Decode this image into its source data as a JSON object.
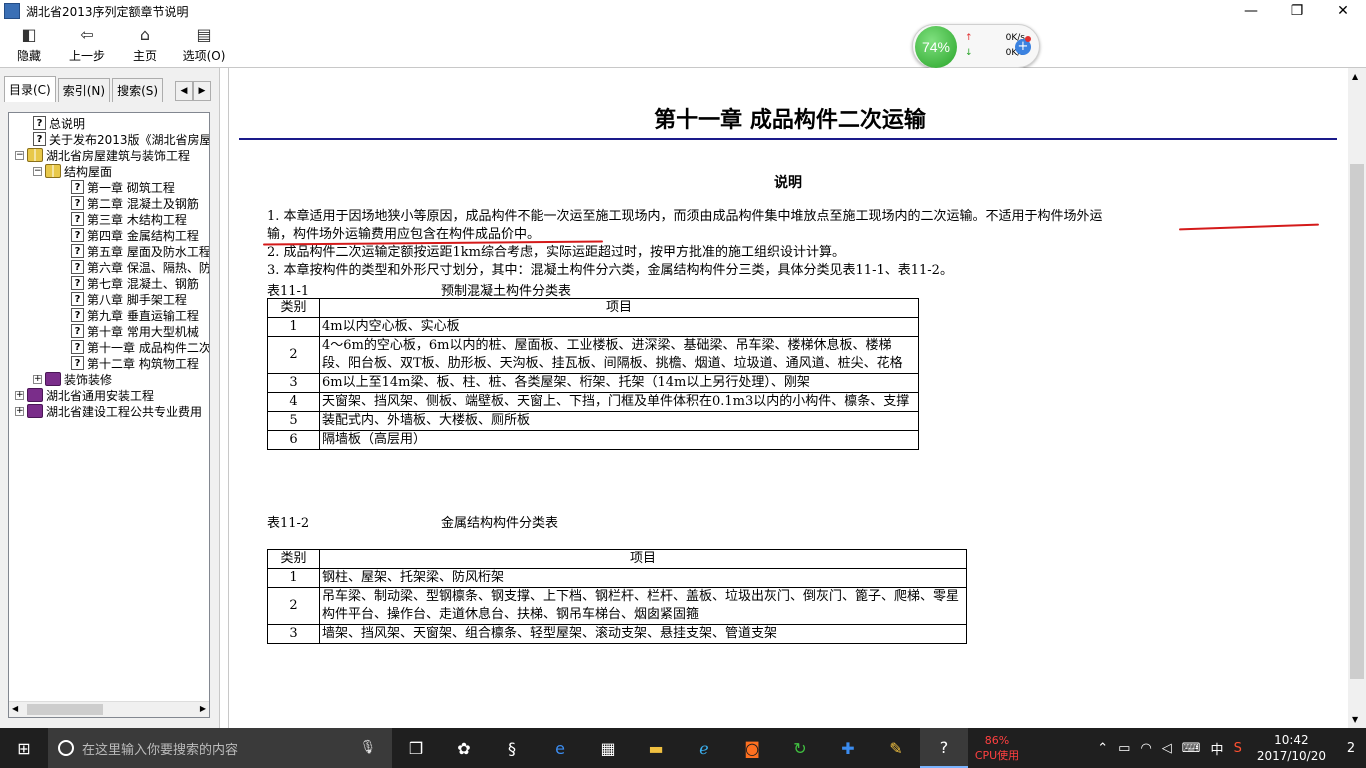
{
  "window": {
    "title": "湖北省2013序列定额章节说明"
  },
  "toolbar": {
    "hide": "隐藏",
    "back": "上一步",
    "home": "主页",
    "options": "选项(O)"
  },
  "net_widget": {
    "percent": "74%",
    "up": "0K/s",
    "down": "0K/s"
  },
  "left_tabs": {
    "toc": "目录(C)",
    "index": "索引(N)",
    "search": "搜索(S)"
  },
  "tree": [
    {
      "label": "总说明",
      "icon": "help-page-icon"
    },
    {
      "label": "关于发布2013版《湖北省房屋",
      "icon": "help-page-icon"
    },
    {
      "label": "湖北省房屋建筑与装饰工程",
      "icon": "open-book-icon"
    },
    {
      "label": "结构屋面",
      "icon": "open-book-icon"
    },
    {
      "label": "第一章 砌筑工程",
      "icon": "help-page-icon"
    },
    {
      "label": "第二章 混凝土及钢筋",
      "icon": "help-page-icon"
    },
    {
      "label": "第三章 木结构工程",
      "icon": "help-page-icon"
    },
    {
      "label": "第四章 金属结构工程",
      "icon": "help-page-icon"
    },
    {
      "label": "第五章 屋面及防水工程",
      "icon": "help-page-icon"
    },
    {
      "label": "第六章 保温、隔热、防",
      "icon": "help-page-icon"
    },
    {
      "label": "第七章 混凝土、钢筋",
      "icon": "help-page-icon"
    },
    {
      "label": "第八章 脚手架工程",
      "icon": "help-page-icon"
    },
    {
      "label": "第九章 垂直运输工程",
      "icon": "help-page-icon"
    },
    {
      "label": "第十章 常用大型机械",
      "icon": "help-page-icon"
    },
    {
      "label": "第十一章 成品构件二次",
      "icon": "help-page-icon"
    },
    {
      "label": "第十二章 构筑物工程",
      "icon": "help-page-icon"
    },
    {
      "label": "装饰装修",
      "icon": "closed-book-icon"
    },
    {
      "label": "湖北省通用安装工程",
      "icon": "closed-book-icon"
    },
    {
      "label": "湖北省建设工程公共专业费用",
      "icon": "closed-book-icon"
    }
  ],
  "content": {
    "chapter_title": "第十一章 成品构件二次运输",
    "section_title": "说明",
    "para1_line1": "1. 本章适用于因场地狭小等原因，成品构件不能一次运至施工现场内，而须由成品构件集中堆放点至施工现场内的二次运输。不适用于构件场外运",
    "para1_line2": "输，构件场外运输费用应包含在构件成品价中。",
    "para2": "2. 成品构件二次运输定额按运距1km综合考虑，实际运距超过时，按甲方批准的施工组织设计计算。",
    "para3": "3. 本章按构件的类型和外形尺寸划分，其中：混凝土构件分六类，金属结构构件分三类，具体分类见表11-1、表11-2。",
    "table1": {
      "label": "表11-1",
      "name": "预制混凝土构件分类表",
      "headers": [
        "类别",
        "项目"
      ],
      "rows": [
        [
          "1",
          "4m以内空心板、实心板"
        ],
        [
          "2",
          "4～6m的空心板，6m以内的桩、屋面板、工业楼板、进深梁、基础梁、吊车梁、楼梯休息板、楼梯段、阳台板、双T板、肋形板、天沟板、挂瓦板、间隔板、挑檐、烟道、垃圾道、通风道、桩尖、花格"
        ],
        [
          "3",
          "6m以上至14m梁、板、柱、桩、各类屋架、桁架、托架（14m以上另行处理）、刚架"
        ],
        [
          "4",
          "天窗架、挡风架、侧板、端壁板、天窗上、下挡，门框及单件体积在0.1m3以内的小构件、檩条、支撑"
        ],
        [
          "5",
          "装配式内、外墙板、大楼板、厕所板"
        ],
        [
          "6",
          "隔墙板（高层用）"
        ]
      ]
    },
    "table2": {
      "label": "表11-2",
      "name": "金属结构构件分类表",
      "headers": [
        "类别",
        "项目"
      ],
      "rows": [
        [
          "1",
          "钢柱、屋架、托架梁、防风桁架"
        ],
        [
          "2",
          "吊车梁、制动梁、型钢檩条、钢支撑、上下档、钢栏杆、栏杆、盖板、垃圾出灰门、倒灰门、篦子、爬梯、零星构件平台、操作台、走道休息台、扶梯、钢吊车梯台、烟囱紧固箍"
        ],
        [
          "3",
          "墙架、挡风架、天窗架、组合檩条、轻型屋架、滚动支架、悬挂支架、管道支架"
        ]
      ]
    }
  },
  "taskbar": {
    "search_placeholder": "在这里输入你要搜索的内容",
    "cpu_percent": "86%",
    "cpu_label": "CPU使用",
    "ime": "中",
    "time": "10:42",
    "date": "2017/10/20",
    "notification_count": "2"
  }
}
